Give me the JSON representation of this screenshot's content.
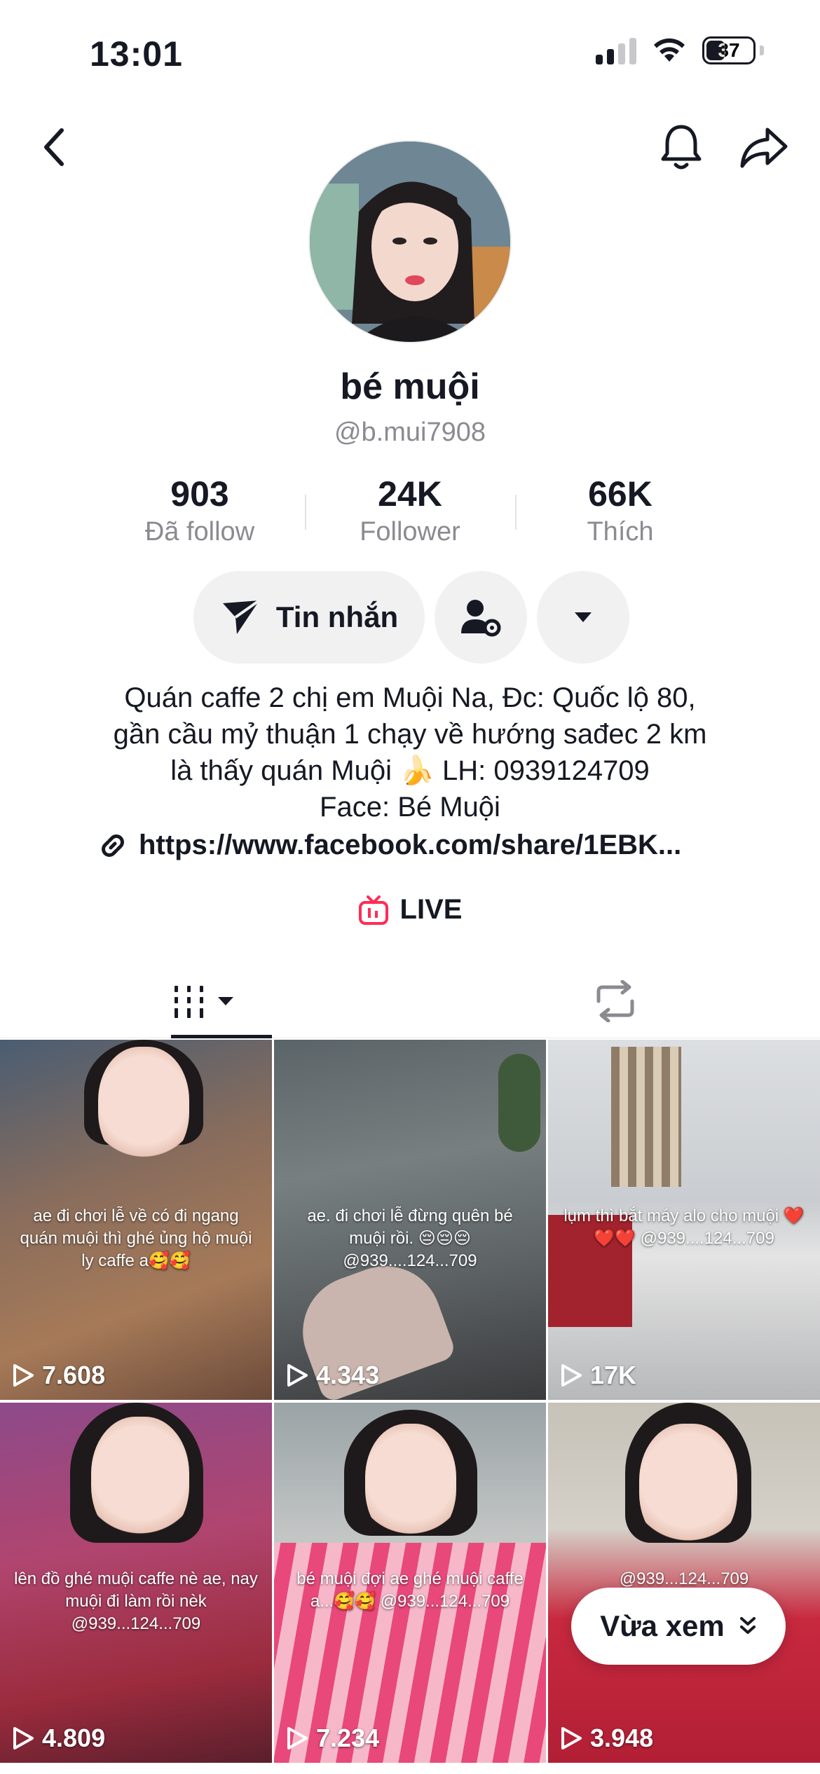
{
  "status_bar": {
    "time": "13:01",
    "battery": "37"
  },
  "profile": {
    "display_name": "bé muội",
    "handle": "@b.mui7908",
    "stats": [
      {
        "value": "903",
        "label": "Đã follow"
      },
      {
        "value": "24K",
        "label": "Follower"
      },
      {
        "value": "66K",
        "label": "Thích"
      }
    ],
    "message_button": "Tin nhắn",
    "bio_lines": [
      "Quán caffe 2 chị em Muội Na, Đc: Quốc lộ 80,",
      "gần cầu mỷ thuận 1 chạy về hướng sađec 2 km",
      "là thấy quán Muội 🍌 LH: 0939124709",
      "Face: Bé Muội"
    ],
    "link": "https://www.facebook.com/share/1EBK...",
    "live_label": "LIVE"
  },
  "videos": [
    {
      "views": "7.608",
      "caption": "ae đi chơi lễ về có đi ngang quán muội thì ghé ủng hộ muội ly caffe a🥰🥰"
    },
    {
      "views": "4.343",
      "caption": "ae. đi chơi lễ đừng quên bé muội rồi. 😔😔😔 @939....124...709"
    },
    {
      "views": "17K",
      "caption": "lụm thì bắt máy alo cho muội ❤️❤️❤️ @939....124...709"
    },
    {
      "views": "4.809",
      "caption": "lên đồ ghé muội caffe nè ae, nay muội đi làm rồi nèk @939...124...709"
    },
    {
      "views": "7.234",
      "caption": "bé muội đợi ae ghé muội caffe a...🥰🥰 @939...124...709"
    },
    {
      "views": "3.948",
      "caption": "@939...124...709"
    }
  ],
  "recent_button": "Vừa xem",
  "colors": {
    "live_accent": "#fe2c55",
    "text": "#161823",
    "muted": "#8a8b91",
    "button_bg": "#f1f1f2"
  }
}
